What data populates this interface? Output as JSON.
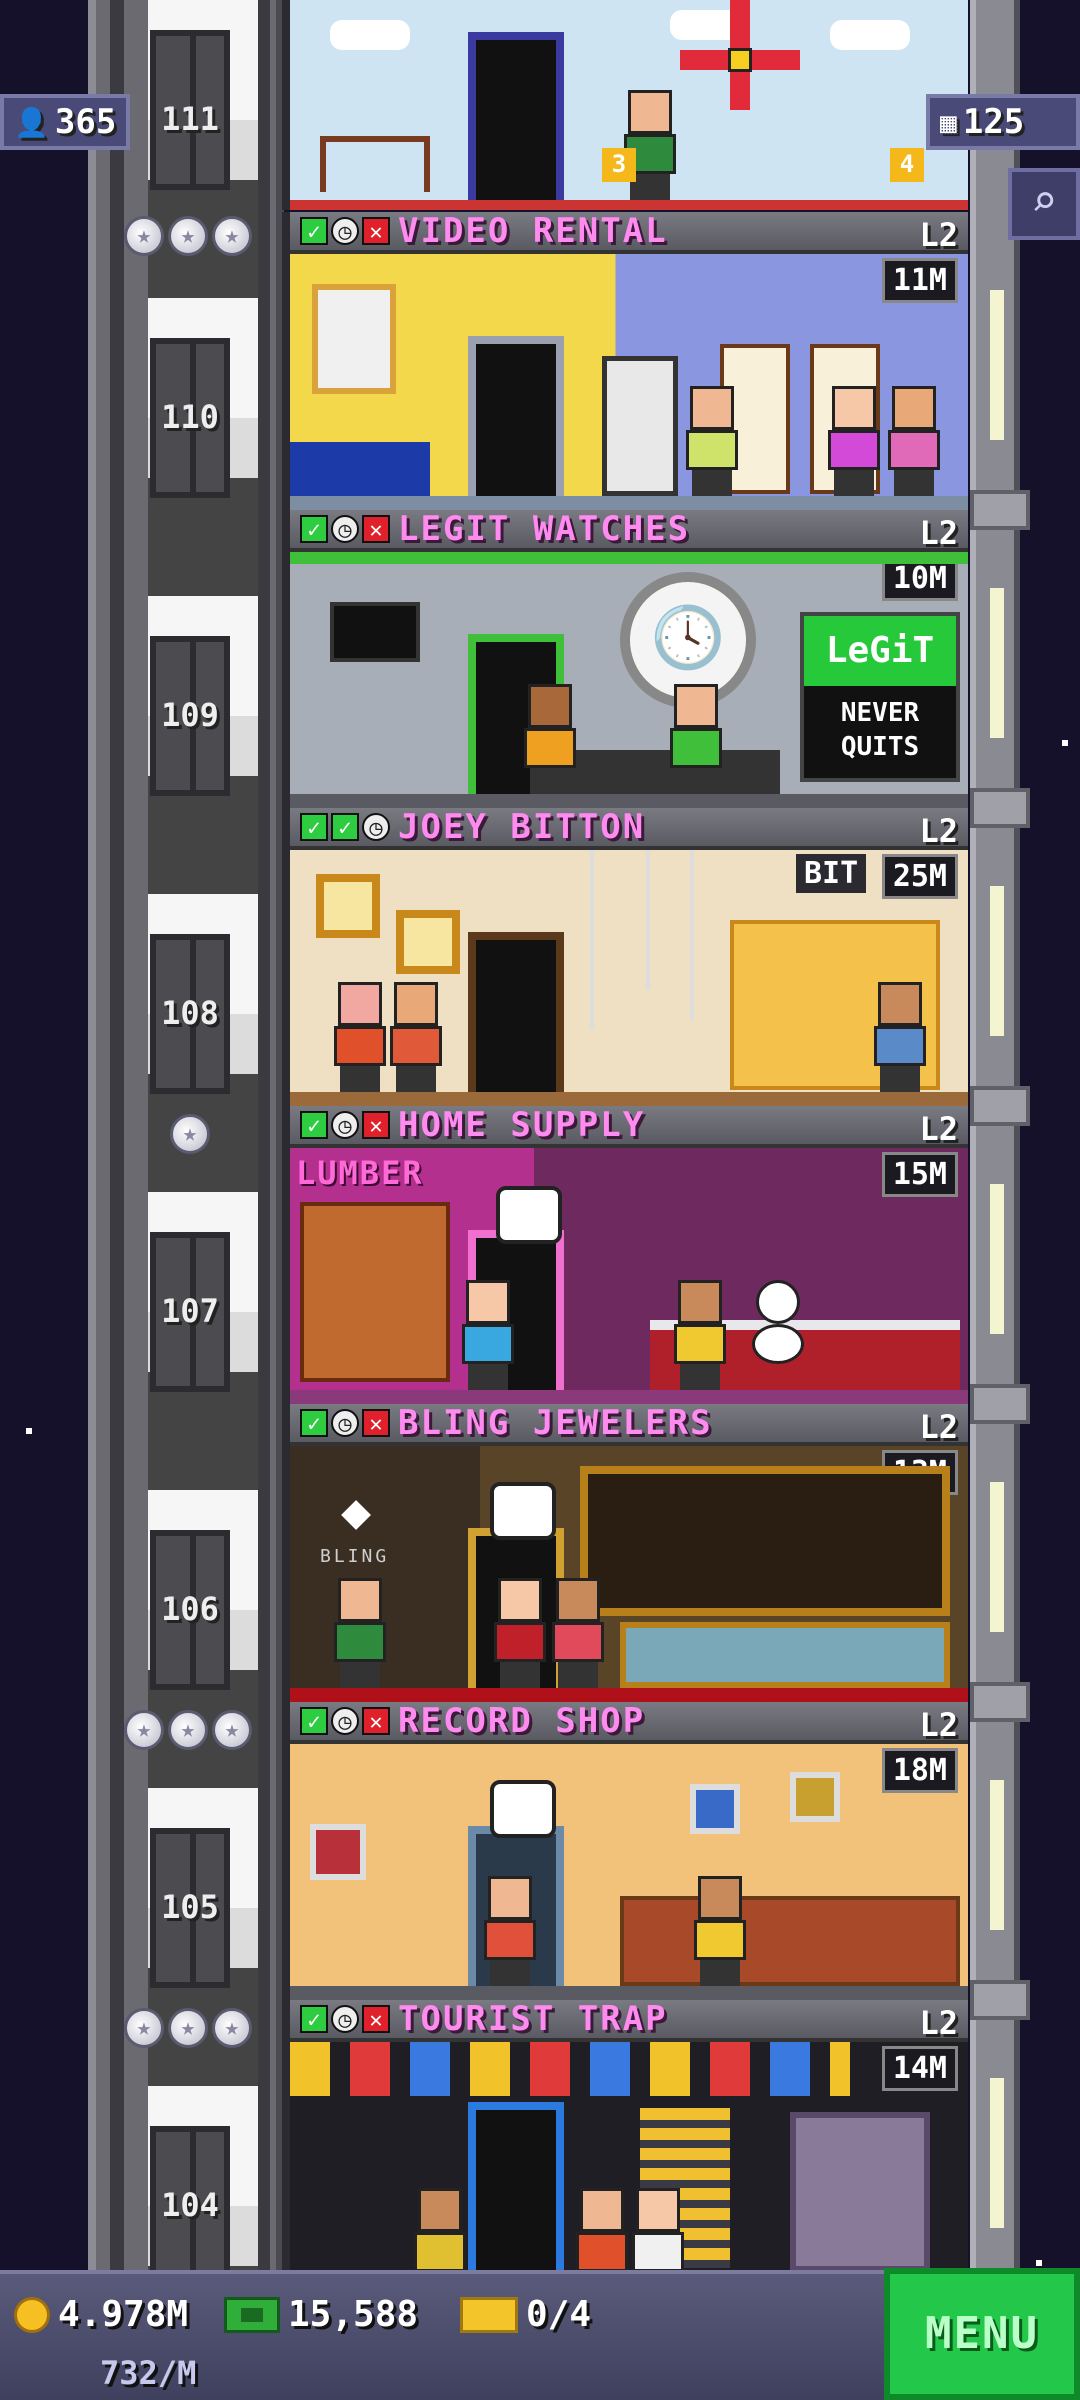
{
  "top_left_badge": {
    "icon": "population-icon",
    "value": "365"
  },
  "top_right_badge": {
    "icon": "floors-icon",
    "value": "125"
  },
  "search_button": {
    "icon": "search-icon"
  },
  "top_floor": {
    "number": "111",
    "sign_left": "3",
    "sign_right": "4"
  },
  "floors": [
    {
      "number": "110",
      "name": "VIDEO RENTAL",
      "level": "L2",
      "stock": "11M",
      "status": [
        "ok",
        "clock",
        "x"
      ],
      "wall": "#f2d84a",
      "wall2": "#8a96e0",
      "stars": 3
    },
    {
      "number": "109",
      "name": "LEGIT WATCHES",
      "level": "L2",
      "stock": "10M",
      "status": [
        "ok",
        "clock",
        "x"
      ],
      "wall": "#a8aeb8",
      "wall2": "#8e96a2",
      "stars": 0,
      "sign_top": "LeGiT",
      "sign_bottom": "NEVER QUITS"
    },
    {
      "number": "108",
      "name": "JOEY BITTON",
      "level": "L2",
      "stock": "25M",
      "status": [
        "ok",
        "ok",
        "clock"
      ],
      "wall": "#efe0c4",
      "wall2": "#e6d2ae",
      "stars": 0,
      "sign_top": "BIT"
    },
    {
      "number": "107",
      "name": "HOME SUPPLY",
      "level": "L2",
      "stock": "15M",
      "status": [
        "ok",
        "clock",
        "x"
      ],
      "wall": "#b4308e",
      "wall2": "#6e2a5e",
      "stars": 1,
      "sign_top": "LUMBER"
    },
    {
      "number": "106",
      "name": "BLING JEWELERS",
      "level": "L2",
      "stock": "13M",
      "status": [
        "ok",
        "clock",
        "x"
      ],
      "wall": "#3a2e22",
      "wall2": "#5a4428",
      "stars": 0,
      "sign_top": "BLING"
    },
    {
      "number": "105",
      "name": "RECORD SHOP",
      "level": "L2",
      "stock": "18M",
      "status": [
        "ok",
        "clock",
        "x"
      ],
      "wall": "#f2c27a",
      "wall2": "#e0aa62",
      "stars": 3
    },
    {
      "number": "104",
      "name": "TOURIST TRAP",
      "level": "L2",
      "stock": "14M",
      "status": [
        "ok",
        "clock",
        "x"
      ],
      "wall": "#1e1e24",
      "wall2": "#2c2c34",
      "stars": 3
    }
  ],
  "hud": {
    "coins": "4.978M",
    "coins_per_min": "732/M",
    "bux": "15,588",
    "tickets": "0/4",
    "menu_label": "MENU"
  }
}
